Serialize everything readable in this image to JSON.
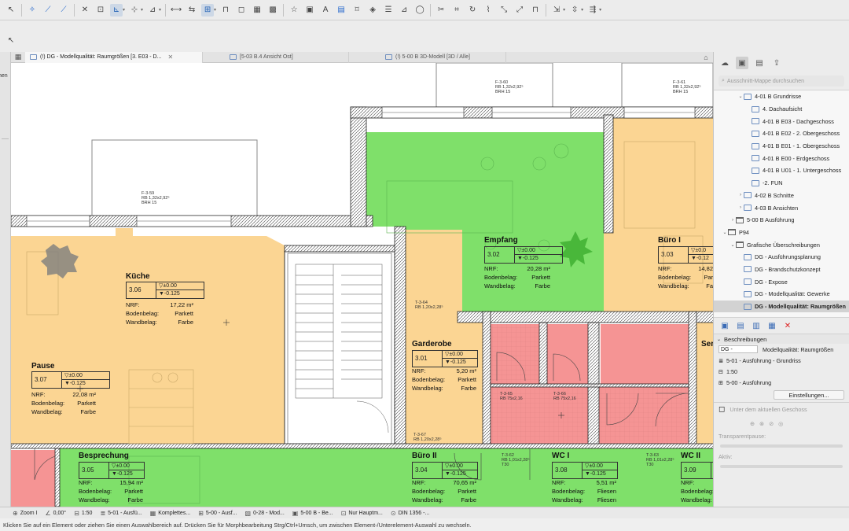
{
  "colors": {
    "zone_orange": "#fbd593",
    "zone_green": "#7fe06a",
    "zone_red": "#f59494",
    "selection": "#d2d2d2",
    "accent": "#2266cc"
  },
  "tabs": [
    {
      "label": "(!) DG - Modellqualität: Raumgrößen [3. E03 - D...",
      "active": true
    },
    {
      "label": "[5-03 B.4 Ansicht Ost]",
      "active": false
    },
    {
      "label": "(!) 5-00 B 3D-Modell [3D / Alle]",
      "active": false
    }
  ],
  "leftstrip": {
    "label": "hen"
  },
  "zones": [
    {
      "name": "Küche",
      "number": "3.06",
      "top": "▽±0.00",
      "bottom": "▼-0.125",
      "nrf_label": "NRF:",
      "nrf": "17,22 m²",
      "boden_label": "Bodenbelag:",
      "boden": "Parkett",
      "wand_label": "Wandbelag:",
      "wand": "Farbe"
    },
    {
      "name": "Pause",
      "number": "3.07",
      "top": "▽±0.00",
      "bottom": "▼-0.125",
      "nrf_label": "NRF:",
      "nrf": "22,08 m²",
      "boden_label": "Bodenbelag:",
      "boden": "Parkett",
      "wand_label": "Wandbelag:",
      "wand": "Farbe"
    },
    {
      "name": "Empfang",
      "number": "3.02",
      "top": "▽±0.00",
      "bottom": "▼-0.125",
      "nrf_label": "NRF:",
      "nrf": "20,28 m²",
      "boden_label": "Bodenbelag:",
      "boden": "Parkett",
      "wand_label": "Wandbelag:",
      "wand": "Farbe"
    },
    {
      "name": "Büro I",
      "number": "3.03",
      "top": "▽±0.0",
      "bottom": "▼-0.12",
      "nrf_label": "NRF:",
      "nrf": "14,82",
      "boden_label": "Bodenbelag:",
      "boden": "Par",
      "wand_label": "Wandbelag:",
      "wand": "Fa"
    },
    {
      "name": "Garderobe",
      "number": "3.01",
      "top": "▽±0.00",
      "bottom": "▼-0.125",
      "nrf_label": "NRF:",
      "nrf": "5,20 m²",
      "boden_label": "Bodenbelag:",
      "boden": "Parkett",
      "wand_label": "Wandbelag:",
      "wand": "Farbe"
    },
    {
      "name": "Besprechung",
      "number": "3.05",
      "top": "▽±0.00",
      "bottom": "▼-0.125",
      "nrf_label": "NRF:",
      "nrf": "15,94 m²",
      "boden_label": "Bodenbelag:",
      "boden": "Parkett",
      "wand_label": "Wandbelag:",
      "wand": "Farbe"
    },
    {
      "name": "Büro II",
      "number": "3.04",
      "top": "▽±0.00",
      "bottom": "▼-0.125",
      "nrf_label": "NRF:",
      "nrf": "70,65 m²",
      "boden_label": "Bodenbelag:",
      "boden": "Parkett",
      "wand_label": "Wandbelag:",
      "wand": "Farbe"
    },
    {
      "name": "WC I",
      "number": "3.08",
      "top": "▽±0.00",
      "bottom": "▼-0.125",
      "nrf_label": "NRF:",
      "nrf": "5,51 m²",
      "boden_label": "Bodenbelag:",
      "boden": "Fliesen",
      "wand_label": "Wandbelag:",
      "wand": "Fliesen"
    },
    {
      "name": "WC II",
      "number": "3.09",
      "top": "",
      "bottom": "",
      "nrf_label": "NRF:",
      "nrf": "",
      "boden_label": "Bodenbelag:",
      "boden": "",
      "wand_label": "Wandbelag:",
      "wand": ""
    },
    {
      "name": "Ser",
      "number": "",
      "top": "",
      "bottom": "",
      "nrf_label": "",
      "nrf": "",
      "boden_label": "",
      "boden": "",
      "wand_label": "",
      "wand": ""
    }
  ],
  "window_labels": [
    {
      "id": "F-3-59",
      "l1": "F-3-59",
      "l2": "RB    1,32x2,92⁵",
      "l3": "BRH   15"
    },
    {
      "id": "F-3-60",
      "l1": "F-3-60",
      "l2": "RB    1,32x2,92⁵",
      "l3": "BRH   15"
    },
    {
      "id": "F-3-61",
      "l1": "F-3-61",
      "l2": "RB    1,32x2,92⁵",
      "l3": "BRH   15"
    }
  ],
  "door_labels": [
    {
      "l1": "T-3-64",
      "l2": "RB   1,20x2,28⁵"
    },
    {
      "l1": "T-3-65",
      "l2": "RB   75x2,16"
    },
    {
      "l1": "T-3-66",
      "l2": "RB   75x2,16"
    },
    {
      "l1": "T-3-67",
      "l2": "RB   1,20x2,28⁵"
    },
    {
      "l1": "T-3-62",
      "l2": "RB   1,01x2,28⁵",
      "l3": "T30"
    },
    {
      "l1": "T-3-63",
      "l2": "RB   1,01x2,28⁵",
      "l3": "T30"
    }
  ],
  "navigator": {
    "search_placeholder": "Ausschnitt-Mappe durchsuchen",
    "items": [
      {
        "label": "4-01 B Grundrisse",
        "level": 2,
        "arrow": "⌄",
        "type": "folder-blue"
      },
      {
        "label": "4. Dachaufsicht",
        "level": 3,
        "arrow": "",
        "type": "view"
      },
      {
        "label": "4-01 B E03 - Dachgeschoss",
        "level": 3,
        "arrow": "",
        "type": "view"
      },
      {
        "label": "4-01 B E02 - 2. Obergeschoss",
        "level": 3,
        "arrow": "",
        "type": "view"
      },
      {
        "label": "4-01 B E01 - 1. Obergeschoss",
        "level": 3,
        "arrow": "",
        "type": "view"
      },
      {
        "label": "4-01 B E00 - Erdgeschoss",
        "level": 3,
        "arrow": "",
        "type": "view"
      },
      {
        "label": "4-01 B U01 - 1. Untergeschoss",
        "level": 3,
        "arrow": "",
        "type": "view"
      },
      {
        "label": "-2. FUN",
        "level": 3,
        "arrow": "",
        "type": "view"
      },
      {
        "label": "4-02 B Schnitte",
        "level": 2,
        "arrow": "›",
        "type": "folder-blue"
      },
      {
        "label": "4-03 B Ansichten",
        "level": 2,
        "arrow": "›",
        "type": "folder-blue"
      },
      {
        "label": "5-00 B Ausführung",
        "level": 1,
        "arrow": "›",
        "type": "folder"
      },
      {
        "label": "P94",
        "level": 0,
        "arrow": "⌄",
        "type": "folder"
      },
      {
        "label": "Grafische Überschreibungen",
        "level": 1,
        "arrow": "⌄",
        "type": "folder"
      },
      {
        "label": "DG - Ausführungsplanung",
        "level": 2,
        "arrow": "",
        "type": "view"
      },
      {
        "label": "DG - Brandschutzkonzept",
        "level": 2,
        "arrow": "",
        "type": "view"
      },
      {
        "label": "DG - Expose",
        "level": 2,
        "arrow": "",
        "type": "view"
      },
      {
        "label": "DG - Modellqualität: Gewerke",
        "level": 2,
        "arrow": "",
        "type": "view"
      },
      {
        "label": "DG - Modellqualität: Raumgrößen",
        "level": 2,
        "arrow": "",
        "type": "view",
        "selected": true
      }
    ]
  },
  "properties": {
    "section_title": "Beschreibungen",
    "name_prefix": "DG -",
    "name_value": "Modellqualität: Raumgrößen",
    "rows": [
      "5-01 - Ausführung - Grundriss",
      "1:50",
      "5-00 - Ausführung"
    ],
    "settings_button": "Einstellungen...",
    "under_label": "Unter dem aktuellen Geschoss",
    "transparency_label": "Transparentpause:",
    "active_label": "Aktiv:"
  },
  "statusbar": {
    "items": [
      "Zoom I",
      "0,00°",
      "1:50",
      "5-01 - Ausfü...",
      "Komplettes...",
      "5-00 - Ausf...",
      "0-28 - Mod...",
      "5-00 B - Be...",
      "Nur Hauptm...",
      "DIN 1356 -..."
    ]
  },
  "message": "Klicken Sie auf ein Element oder ziehen Sie einen Auswahlbereich auf. Drücken Sie für Morphbearbeitung Strg/Ctrl+Umsch, um zwischen Element-/Unterelement-Auswahl zu wechseln."
}
